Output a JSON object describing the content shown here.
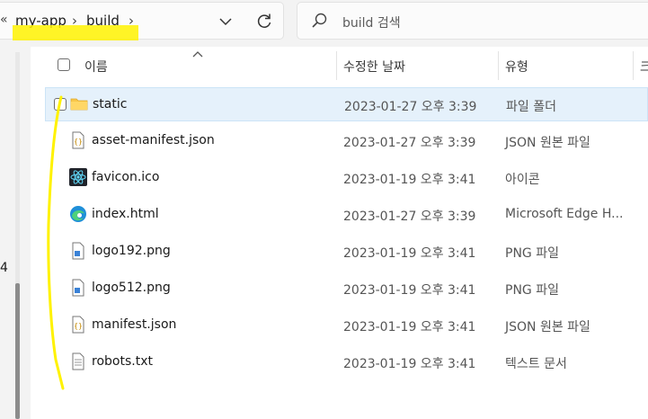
{
  "breadcrumb": {
    "lead": "«",
    "items": [
      "my-app",
      "build"
    ],
    "separator": "›"
  },
  "search": {
    "placeholder": "build 검색"
  },
  "columns": {
    "name": "이름",
    "date": "수정한 날짜",
    "type": "유형",
    "cut": "크"
  },
  "left_cut_text": "4",
  "files": [
    {
      "name": "static",
      "date": "2023-01-27 오후 3:39",
      "type": "파일 폴더",
      "icon": "folder-icon"
    },
    {
      "name": "asset-manifest.json",
      "date": "2023-01-27 오후 3:39",
      "type": "JSON 원본 파일",
      "icon": "json-file-icon"
    },
    {
      "name": "favicon.ico",
      "date": "2023-01-19 오후 3:41",
      "type": "아이콘",
      "icon": "react-icon"
    },
    {
      "name": "index.html",
      "date": "2023-01-27 오후 3:39",
      "type": "Microsoft Edge H...",
      "icon": "edge-icon"
    },
    {
      "name": "logo192.png",
      "date": "2023-01-19 오후 3:41",
      "type": "PNG 파일",
      "icon": "image-file-icon"
    },
    {
      "name": "logo512.png",
      "date": "2023-01-19 오후 3:41",
      "type": "PNG 파일",
      "icon": "image-file-icon"
    },
    {
      "name": "manifest.json",
      "date": "2023-01-19 오후 3:41",
      "type": "JSON 원본 파일",
      "icon": "json-file-icon"
    },
    {
      "name": "robots.txt",
      "date": "2023-01-19 오후 3:41",
      "type": "텍스트 문서",
      "icon": "text-file-icon"
    }
  ],
  "colors": {
    "selection": "#e5f1fb",
    "highlight": "#fff200",
    "folder": "#f8c74a",
    "edge": "#1f8fd8",
    "react": "#61dafb"
  }
}
